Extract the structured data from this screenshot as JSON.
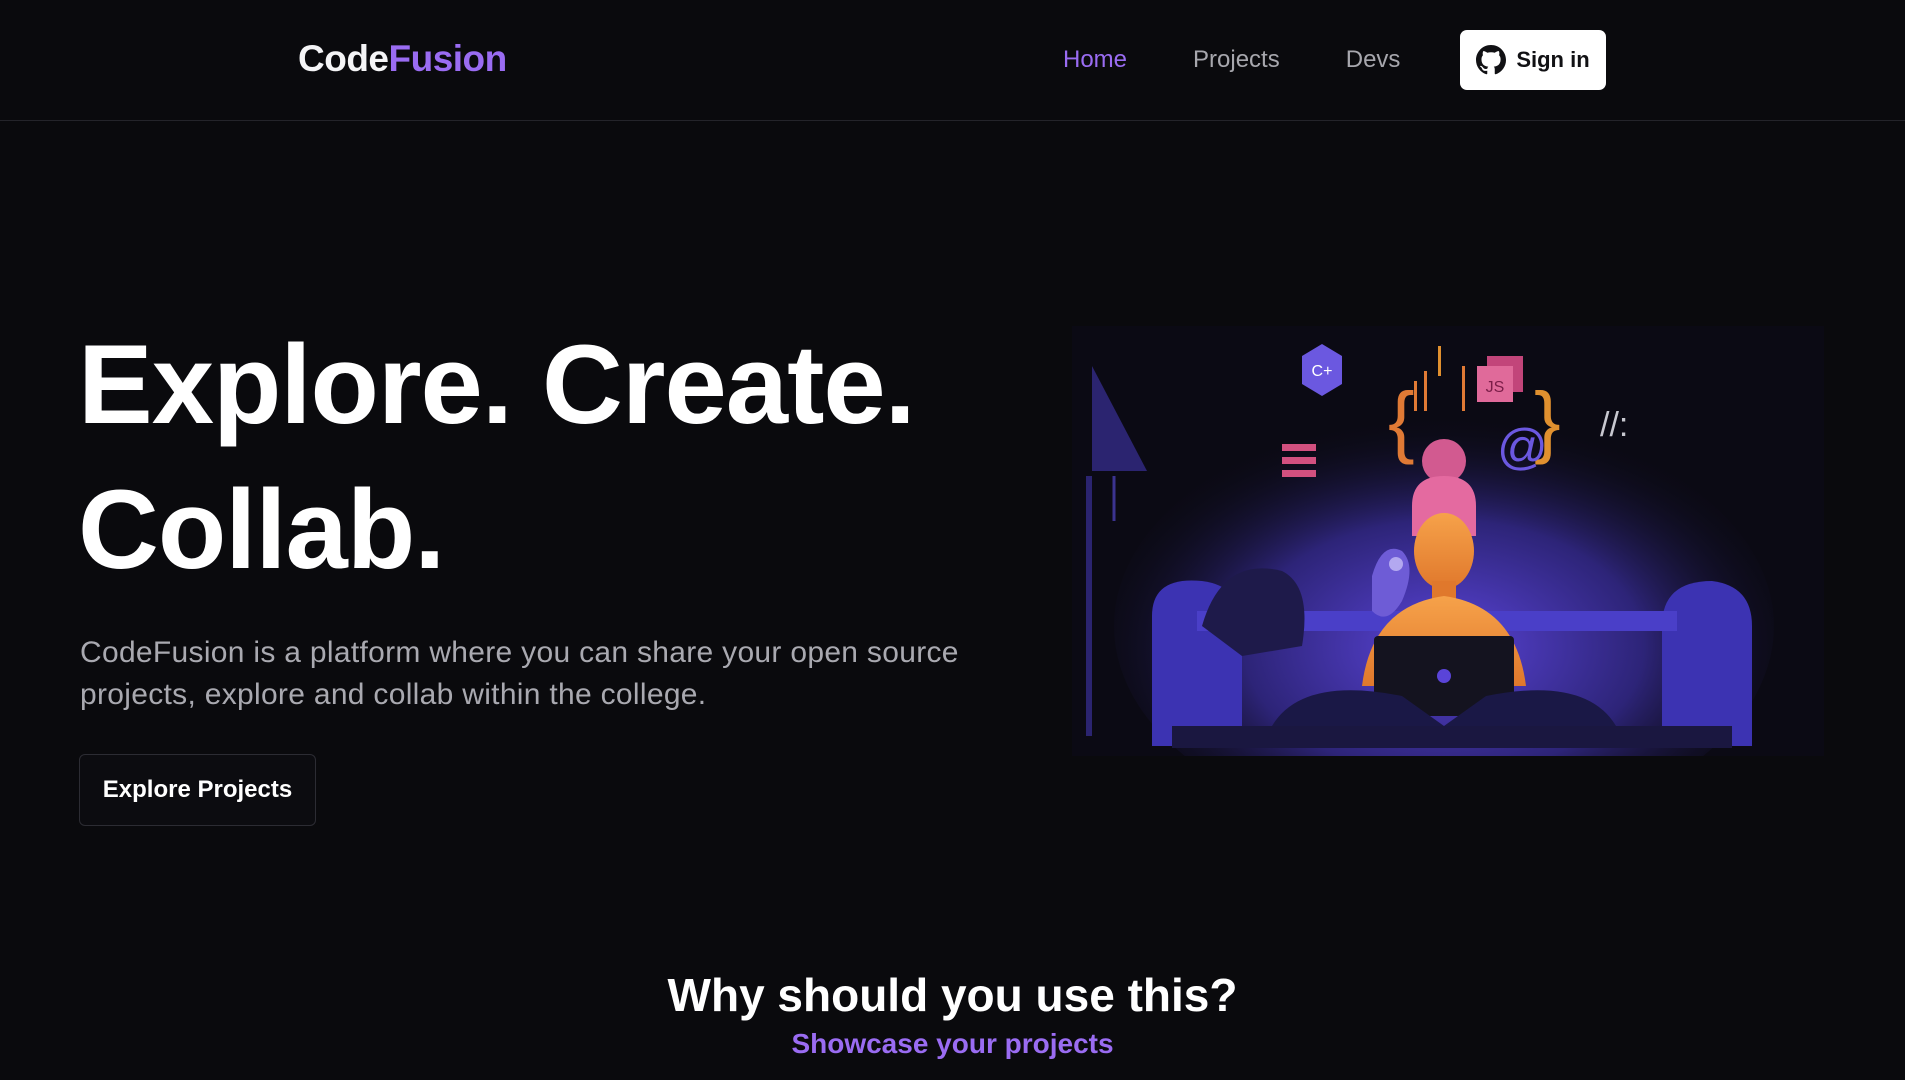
{
  "header": {
    "logo_part1": "Code",
    "logo_part2": "Fusion",
    "nav": [
      "Home",
      "Projects",
      "Devs"
    ],
    "signin_label": "Sign in"
  },
  "hero": {
    "title_line1": "Explore. Create.",
    "title_line2": "Collab.",
    "description": "CodeFusion is a platform where you can share your open source projects, explore and collab within the college.",
    "cta_label": "Explore Projects"
  },
  "illustration": {
    "badges": [
      "C+",
      "JS"
    ]
  },
  "why": {
    "title": "Why should you use this?",
    "subtitle": "Showcase your projects"
  },
  "colors": {
    "background": "#0a0a0d",
    "accent": "#9a6cf2",
    "text_muted": "#a9a9b0"
  }
}
